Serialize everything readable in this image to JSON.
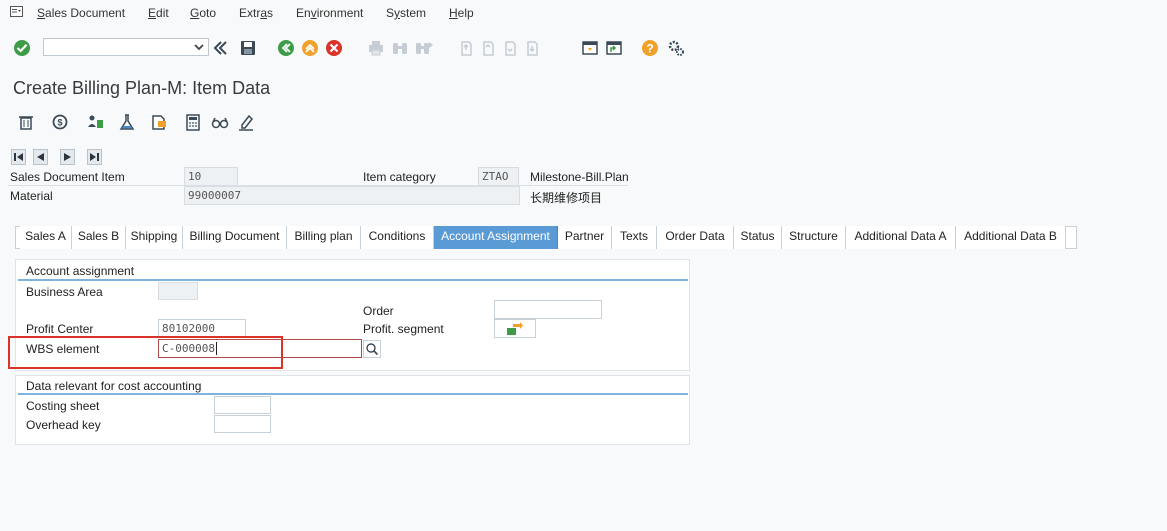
{
  "menu": {
    "items": [
      {
        "pre": "",
        "ul": "S",
        "post": "ales Document"
      },
      {
        "pre": "",
        "ul": "E",
        "post": "dit"
      },
      {
        "pre": "",
        "ul": "G",
        "post": "oto"
      },
      {
        "pre": "Extr",
        "ul": "a",
        "post": "s"
      },
      {
        "pre": "En",
        "ul": "v",
        "post": "ironment"
      },
      {
        "pre": "S",
        "ul": "y",
        "post": "stem"
      },
      {
        "pre": "",
        "ul": "H",
        "post": "elp"
      }
    ]
  },
  "toolbar": {
    "command_field_value": "",
    "icons": [
      "enter-icon",
      "save-icon",
      "back-icon",
      "exit-icon",
      "cancel-icon",
      "print-icon",
      "find-icon",
      "find-next-icon",
      "first-page-icon",
      "previous-page-icon",
      "next-page-icon",
      "last-page-icon",
      "create-session-icon",
      "shortcut-icon",
      "help-icon",
      "customize-layout-icon"
    ]
  },
  "title": "Create Billing Plan-M: Item Data",
  "app_toolbar": {
    "icons": [
      "delete-icon",
      "billing-icon",
      "assign-icon",
      "flask-icon",
      "document-icon",
      "calculator-icon",
      "glasses-icon",
      "edit-icon"
    ]
  },
  "header": {
    "item_label": "Sales Document Item",
    "item_value": "10",
    "material_label": "Material",
    "material_value": "99000007",
    "item_category_label": "Item category",
    "item_category_value": "ZTAO",
    "item_category_desc": "Milestone-Bill.Plan",
    "material_desc": "长期维修项目"
  },
  "tabs": [
    {
      "label": "Sales A"
    },
    {
      "label": "Sales B"
    },
    {
      "label": "Shipping"
    },
    {
      "label": "Billing Document"
    },
    {
      "label": "Billing plan"
    },
    {
      "label": "Conditions"
    },
    {
      "label": "Account Assignment"
    },
    {
      "label": "Partner"
    },
    {
      "label": "Texts"
    },
    {
      "label": "Order Data"
    },
    {
      "label": "Status"
    },
    {
      "label": "Structure"
    },
    {
      "label": "Additional Data A"
    },
    {
      "label": "Additional Data B"
    }
  ],
  "active_tab": "Account Assignment",
  "account_assignment": {
    "title": "Account assignment",
    "business_area_label": "Business Area",
    "business_area_value": "",
    "order_label": "Order",
    "order_value": "",
    "profit_center_label": "Profit Center",
    "profit_center_value": "80102000",
    "profit_segment_label": "Profit. segment",
    "wbs_label": "WBS element",
    "wbs_value": "C-000008"
  },
  "cost_accounting": {
    "title": "Data relevant for cost accounting",
    "costing_sheet_label": "Costing sheet",
    "costing_sheet_value": "",
    "overhead_key_label": "Overhead key",
    "overhead_key_value": ""
  },
  "colors": {
    "active_tab": "#5b9bd5",
    "highlight": "#d9332a",
    "panel_rule": "#7fb2dc"
  }
}
